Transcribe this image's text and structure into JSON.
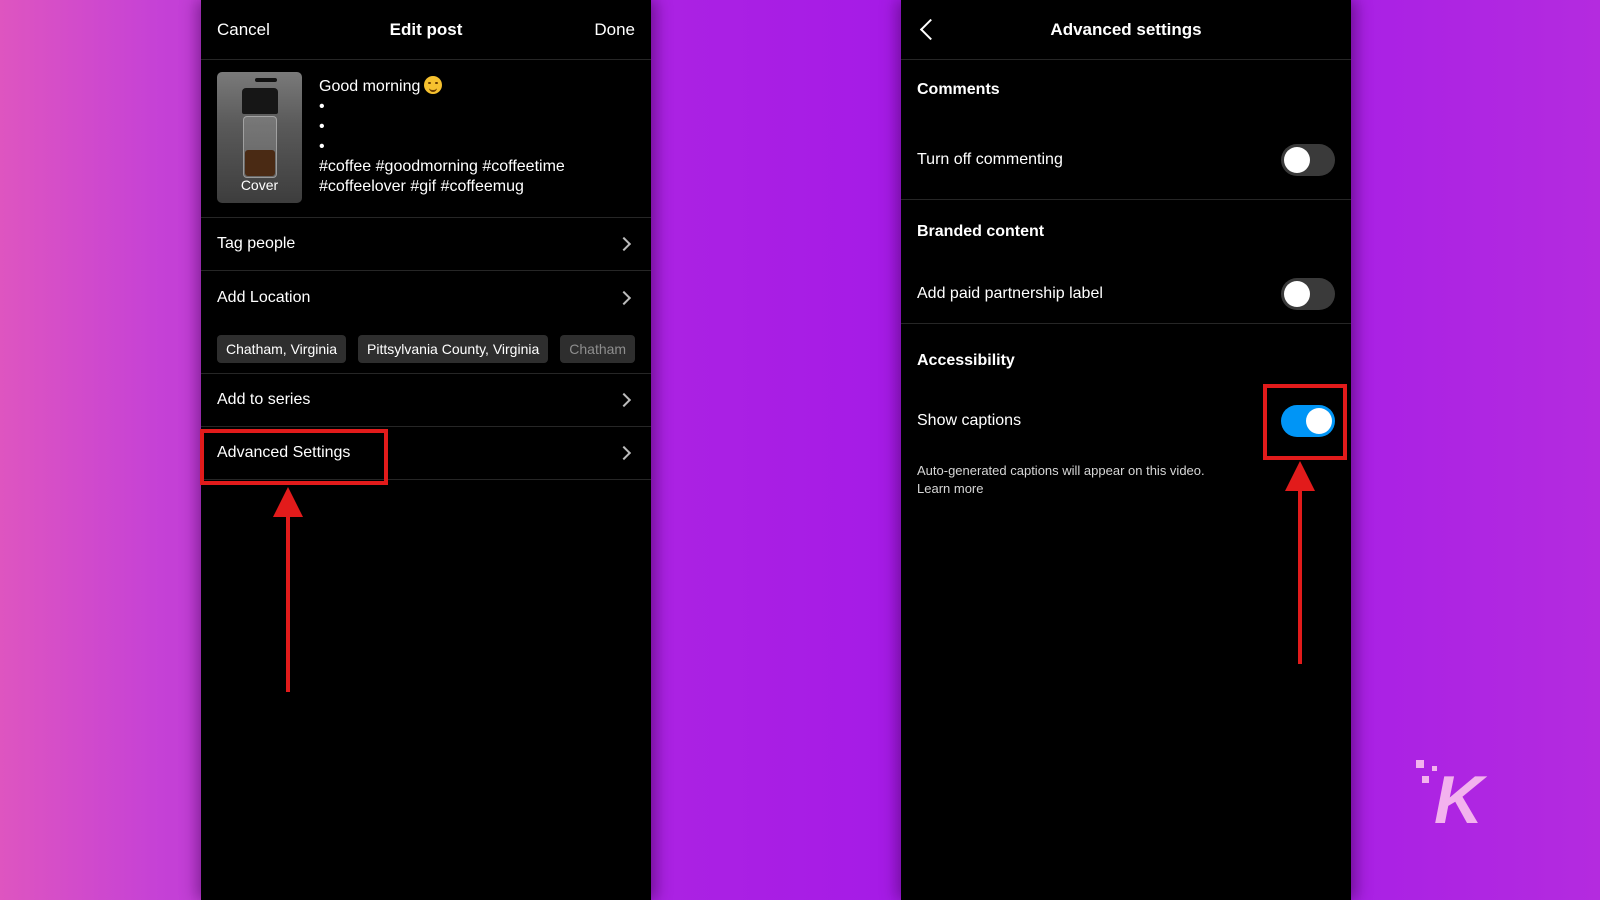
{
  "left_screen": {
    "header": {
      "cancel_label": "Cancel",
      "title": "Edit post",
      "done_label": "Done"
    },
    "post": {
      "cover_label": "Cover",
      "caption_first_line": "Good morning",
      "caption_emoji": "smiling-face",
      "caption_dots": [
        "•",
        "•",
        "•"
      ],
      "hashtags_line1": "#coffee #goodmorning #coffeetime",
      "hashtags_line2": "#coffeelover #gif #coffeemug"
    },
    "rows": {
      "tag_people": "Tag people",
      "add_location": "Add Location",
      "add_to_series": "Add to series",
      "advanced_settings": "Advanced Settings"
    },
    "location_chips": [
      "Chatham, Virginia",
      "Pittsylvania County, Virginia",
      "Chatham"
    ]
  },
  "right_screen": {
    "header": {
      "title": "Advanced settings",
      "back_icon": "chevron-left-icon"
    },
    "comments": {
      "header": "Comments",
      "turn_off_commenting_label": "Turn off commenting",
      "turn_off_commenting_on": false
    },
    "branded": {
      "header": "Branded content",
      "paid_partnership_label": "Add paid partnership label",
      "paid_partnership_on": false
    },
    "accessibility": {
      "header": "Accessibility",
      "show_captions_label": "Show captions",
      "show_captions_on": true,
      "note_line1": "Auto-generated captions will appear on this video.",
      "learn_more": "Learn more"
    }
  },
  "colors": {
    "annotation_red": "#e21b1b",
    "toggle_on": "#0095f6",
    "background_gradient": [
      "#de55c0",
      "#a31ae8"
    ]
  },
  "watermark": {
    "logo": "knowtechie-k-logo"
  }
}
